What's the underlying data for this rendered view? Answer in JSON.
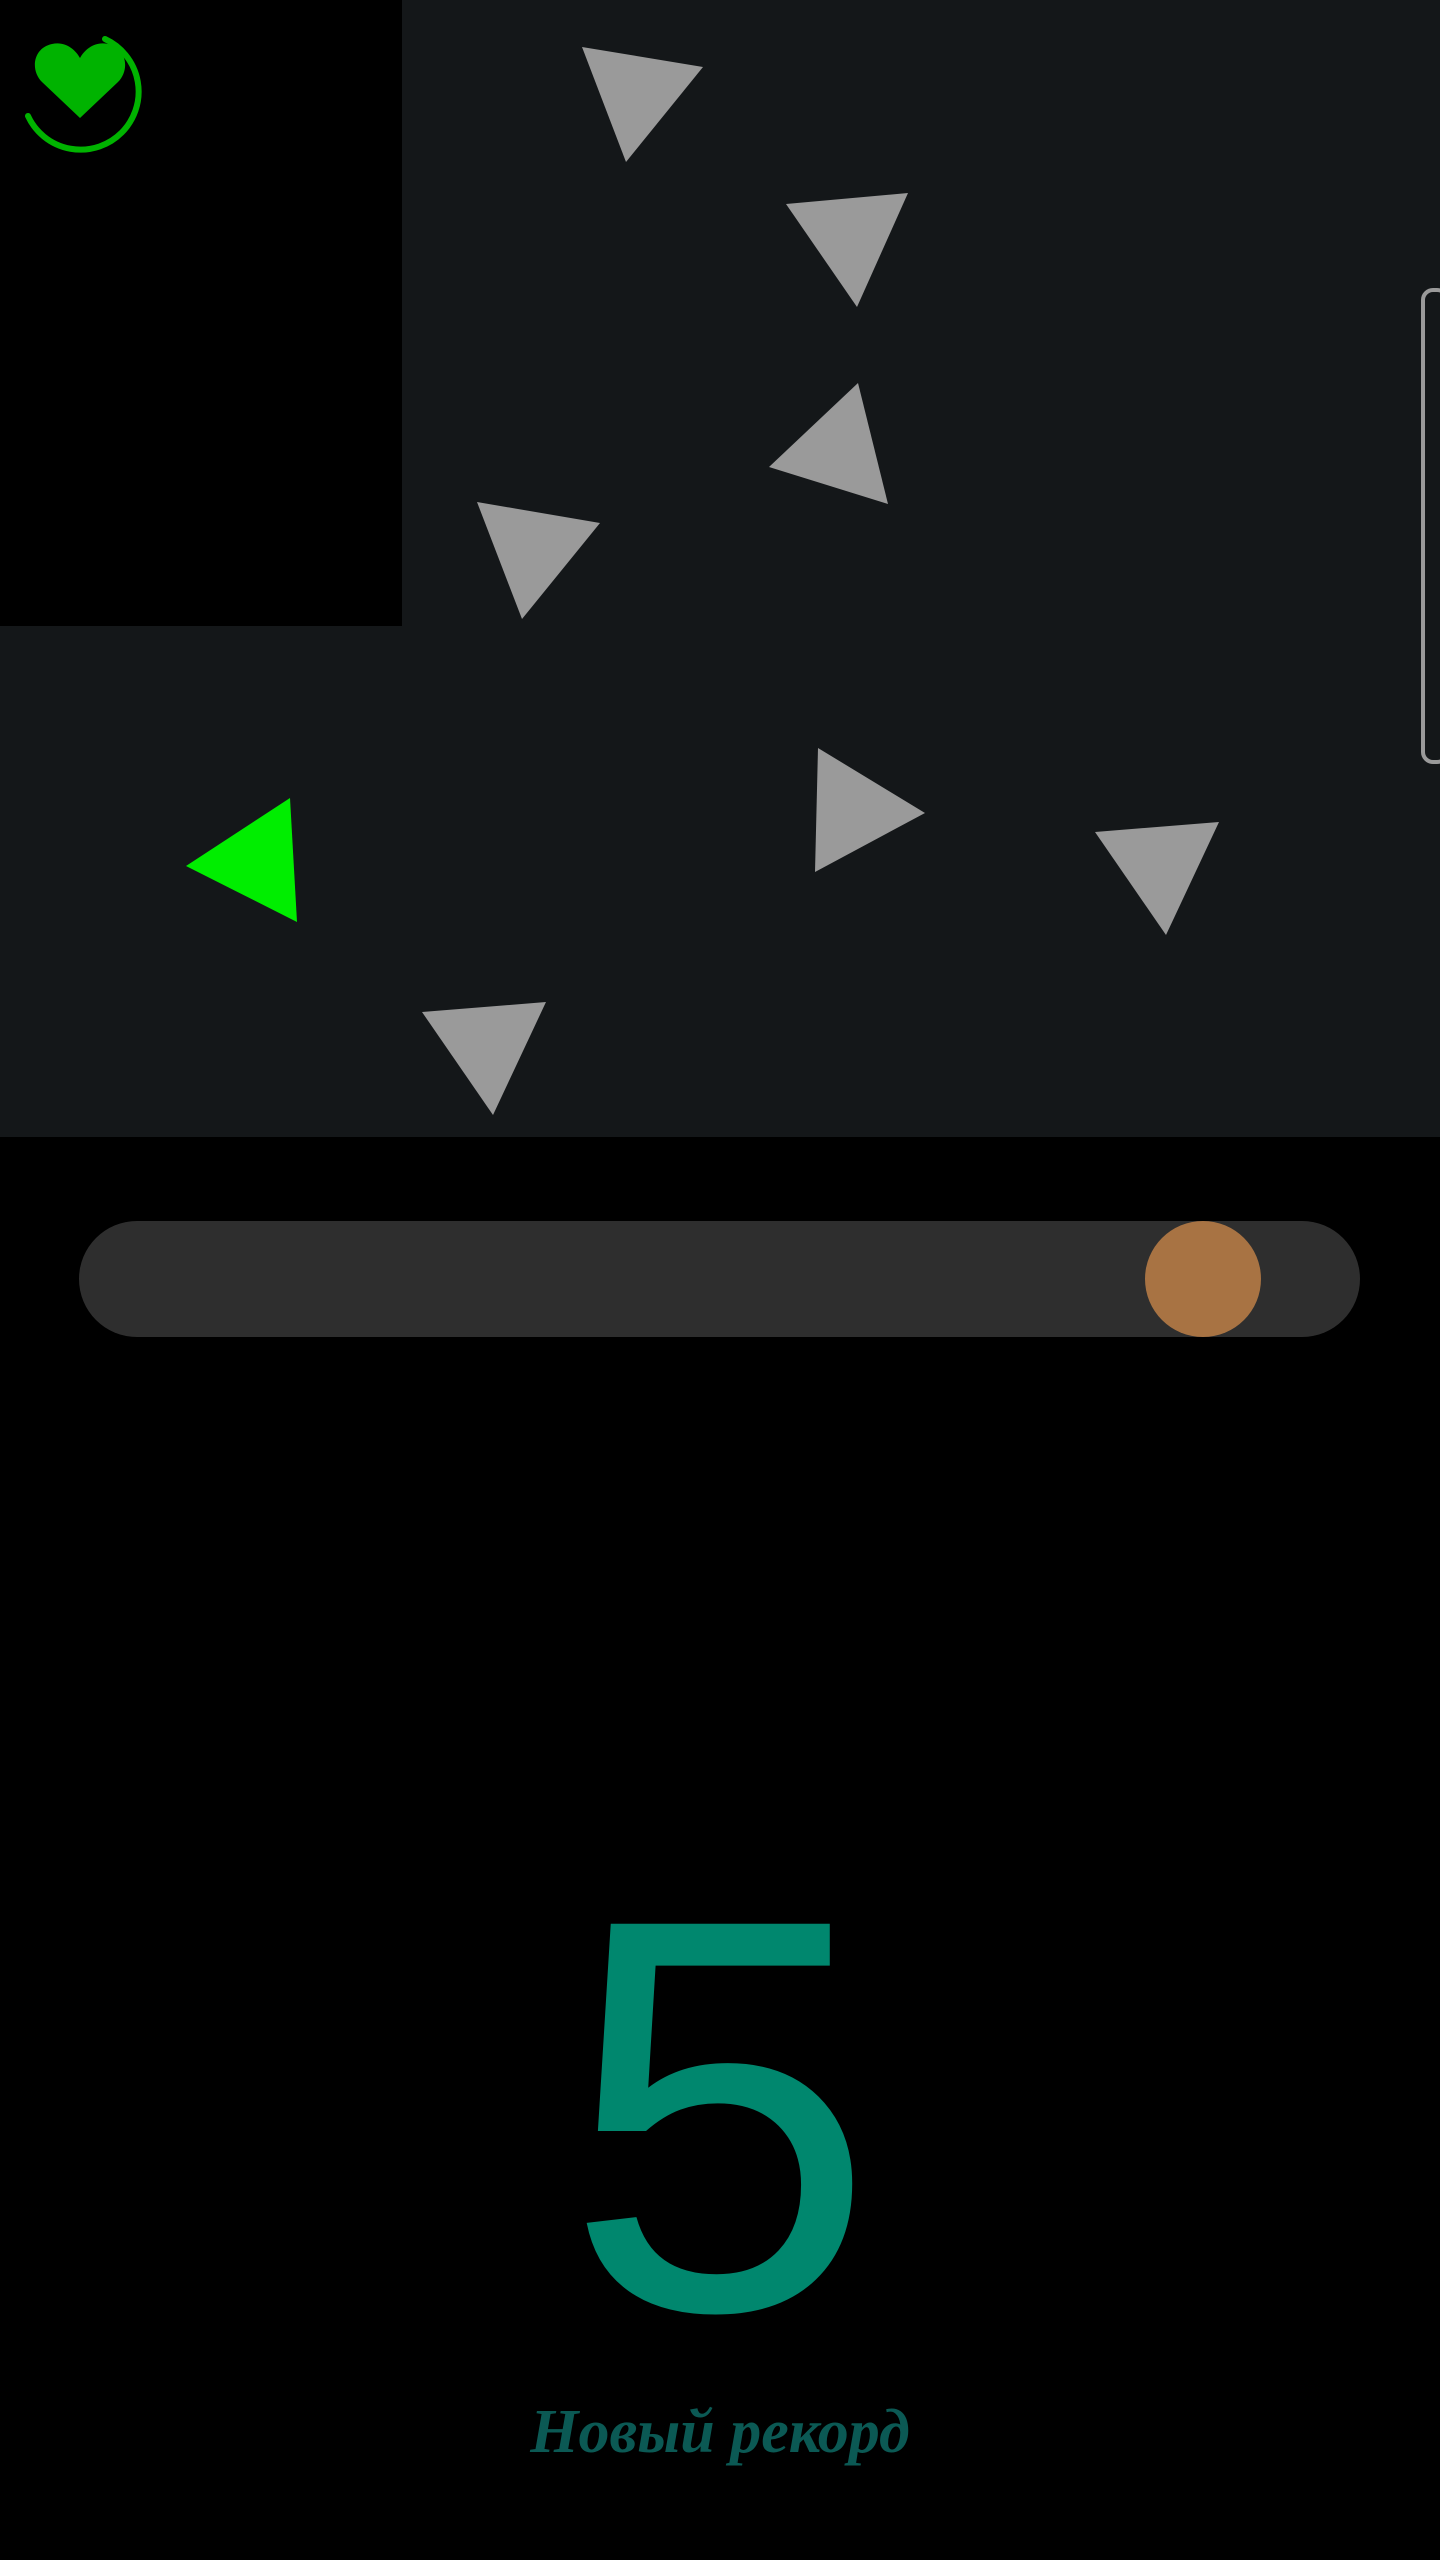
{
  "colors": {
    "background": "#000000",
    "play_area": "#141719",
    "obstacle": "#9a9a9a",
    "player": "#00ee00",
    "heart": "#00b300",
    "slider_track": "#2e2e2e",
    "slider_thumb": "#a87343",
    "score": "#00876e",
    "record": "#0b5954"
  },
  "life": {
    "icon": "heart-icon",
    "ring_icon": "progress-ring-icon"
  },
  "slider": {
    "value": 0.915
  },
  "score": {
    "value": "5",
    "caption": "Новый рекорд"
  }
}
